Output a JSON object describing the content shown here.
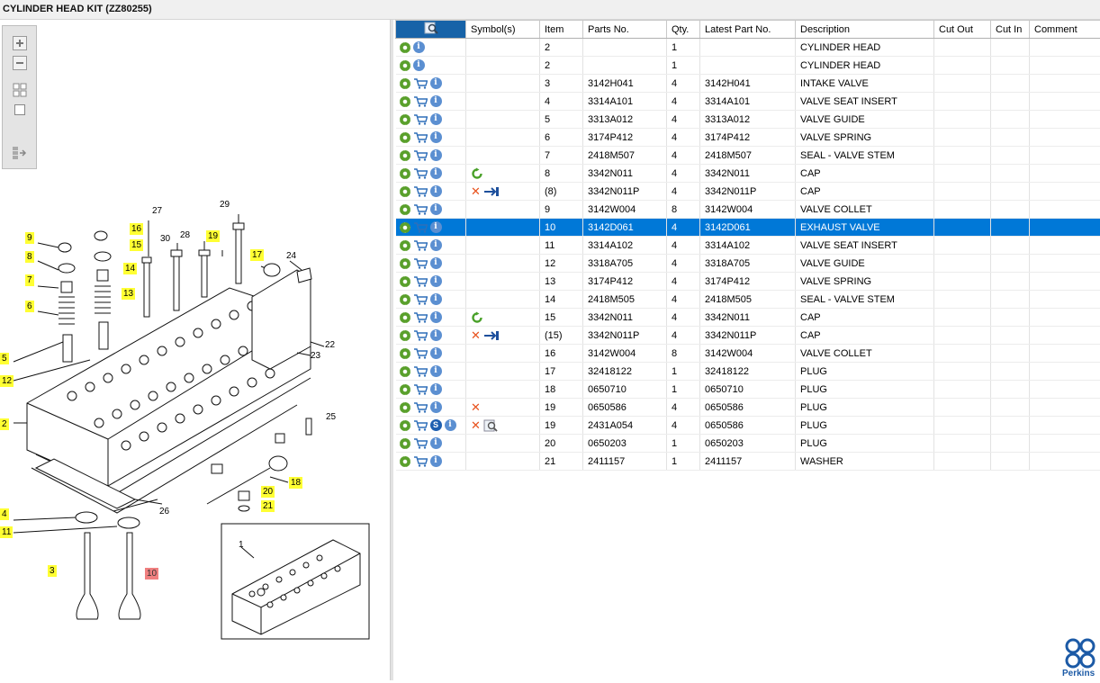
{
  "window": {
    "title": "CYLINDER HEAD KIT (ZZ80255)"
  },
  "toolbox": {
    "buttons": [
      "zoom-in",
      "zoom-out",
      "fit-all",
      "fit-window",
      "select-mode"
    ]
  },
  "diagram": {
    "callouts": [
      {
        "label": "9",
        "style": "hl"
      },
      {
        "label": "16",
        "style": "hl"
      },
      {
        "label": "15",
        "style": "hl"
      },
      {
        "label": "8",
        "style": "hl"
      },
      {
        "label": "14",
        "style": "hl"
      },
      {
        "label": "7",
        "style": "hl"
      },
      {
        "label": "13",
        "style": "hl"
      },
      {
        "label": "6",
        "style": "hl"
      },
      {
        "label": "5",
        "style": "hl"
      },
      {
        "label": "12",
        "style": "hl"
      },
      {
        "label": "2",
        "style": "hl"
      },
      {
        "label": "4",
        "style": "hl"
      },
      {
        "label": "11",
        "style": "hl"
      },
      {
        "label": "3",
        "style": "hl"
      },
      {
        "label": "10",
        "style": "sel"
      },
      {
        "label": "19",
        "style": "hl"
      },
      {
        "label": "17",
        "style": "hl"
      },
      {
        "label": "18",
        "style": "hl"
      },
      {
        "label": "20",
        "style": "hl"
      },
      {
        "label": "21",
        "style": "hl"
      },
      {
        "label": "27",
        "style": "plain"
      },
      {
        "label": "29",
        "style": "plain"
      },
      {
        "label": "30",
        "style": "plain"
      },
      {
        "label": "28",
        "style": "plain"
      },
      {
        "label": "24",
        "style": "plain"
      },
      {
        "label": "22",
        "style": "plain"
      },
      {
        "label": "23",
        "style": "plain"
      },
      {
        "label": "25",
        "style": "plain"
      },
      {
        "label": "26",
        "style": "plain"
      },
      {
        "label": "1",
        "style": "plain"
      }
    ]
  },
  "table": {
    "columns": [
      "",
      "Symbol(s)",
      "Item",
      "Parts No.",
      "Qty.",
      "Latest Part No.",
      "Description",
      "Cut Out",
      "Cut In",
      "Comment"
    ],
    "rows": [
      {
        "icons": [
          "gear",
          "info"
        ],
        "symbols": [],
        "item": "2",
        "part_no": "",
        "qty": "1",
        "latest": "",
        "desc": "CYLINDER HEAD",
        "cut_out": "",
        "cut_in": "",
        "comment": ""
      },
      {
        "icons": [
          "gear",
          "info"
        ],
        "symbols": [],
        "item": "2",
        "part_no": "",
        "qty": "1",
        "latest": "",
        "desc": "CYLINDER HEAD",
        "cut_out": "",
        "cut_in": "",
        "comment": ""
      },
      {
        "icons": [
          "gear",
          "cart",
          "info"
        ],
        "symbols": [],
        "item": "3",
        "part_no": "3142H041",
        "qty": "4",
        "latest": "3142H041",
        "desc": "INTAKE VALVE",
        "cut_out": "",
        "cut_in": "",
        "comment": ""
      },
      {
        "icons": [
          "gear",
          "cart",
          "info"
        ],
        "symbols": [],
        "item": "4",
        "part_no": "3314A101",
        "qty": "4",
        "latest": "3314A101",
        "desc": "VALVE SEAT INSERT",
        "cut_out": "",
        "cut_in": "",
        "comment": ""
      },
      {
        "icons": [
          "gear",
          "cart",
          "info"
        ],
        "symbols": [],
        "item": "5",
        "part_no": "3313A012",
        "qty": "4",
        "latest": "3313A012",
        "desc": "VALVE GUIDE",
        "cut_out": "",
        "cut_in": "",
        "comment": ""
      },
      {
        "icons": [
          "gear",
          "cart",
          "info"
        ],
        "symbols": [],
        "item": "6",
        "part_no": "3174P412",
        "qty": "4",
        "latest": "3174P412",
        "desc": "VALVE SPRING",
        "cut_out": "",
        "cut_in": "",
        "comment": ""
      },
      {
        "icons": [
          "gear",
          "cart",
          "info"
        ],
        "symbols": [],
        "item": "7",
        "part_no": "2418M507",
        "qty": "4",
        "latest": "2418M507",
        "desc": "SEAL - VALVE STEM",
        "cut_out": "",
        "cut_in": "",
        "comment": ""
      },
      {
        "icons": [
          "gear",
          "cart",
          "info"
        ],
        "symbols": [
          "refresh"
        ],
        "item": "8",
        "part_no": "3342N011",
        "qty": "4",
        "latest": "3342N011",
        "desc": "CAP",
        "cut_out": "",
        "cut_in": "",
        "comment": ""
      },
      {
        "icons": [
          "gear",
          "cart",
          "info"
        ],
        "symbols": [
          "cross",
          "arrow"
        ],
        "item": "(8)",
        "part_no": "3342N011P",
        "qty": "4",
        "latest": "3342N011P",
        "desc": "CAP",
        "cut_out": "",
        "cut_in": "",
        "comment": ""
      },
      {
        "icons": [
          "gear",
          "cart",
          "info"
        ],
        "symbols": [],
        "item": "9",
        "part_no": "3142W004",
        "qty": "8",
        "latest": "3142W004",
        "desc": "VALVE COLLET",
        "cut_out": "",
        "cut_in": "",
        "comment": ""
      },
      {
        "icons": [
          "gear",
          "cart",
          "info"
        ],
        "symbols": [],
        "item": "10",
        "part_no": "3142D061",
        "qty": "4",
        "latest": "3142D061",
        "desc": "EXHAUST VALVE",
        "cut_out": "",
        "cut_in": "",
        "comment": "",
        "selected": true
      },
      {
        "icons": [
          "gear",
          "cart",
          "info"
        ],
        "symbols": [],
        "item": "11",
        "part_no": "3314A102",
        "qty": "4",
        "latest": "3314A102",
        "desc": "VALVE SEAT INSERT",
        "cut_out": "",
        "cut_in": "",
        "comment": ""
      },
      {
        "icons": [
          "gear",
          "cart",
          "info"
        ],
        "symbols": [],
        "item": "12",
        "part_no": "3318A705",
        "qty": "4",
        "latest": "3318A705",
        "desc": "VALVE GUIDE",
        "cut_out": "",
        "cut_in": "",
        "comment": ""
      },
      {
        "icons": [
          "gear",
          "cart",
          "info"
        ],
        "symbols": [],
        "item": "13",
        "part_no": "3174P412",
        "qty": "4",
        "latest": "3174P412",
        "desc": "VALVE SPRING",
        "cut_out": "",
        "cut_in": "",
        "comment": ""
      },
      {
        "icons": [
          "gear",
          "cart",
          "info"
        ],
        "symbols": [],
        "item": "14",
        "part_no": "2418M505",
        "qty": "4",
        "latest": "2418M505",
        "desc": "SEAL - VALVE STEM",
        "cut_out": "",
        "cut_in": "",
        "comment": ""
      },
      {
        "icons": [
          "gear",
          "cart",
          "info"
        ],
        "symbols": [
          "refresh"
        ],
        "item": "15",
        "part_no": "3342N011",
        "qty": "4",
        "latest": "3342N011",
        "desc": "CAP",
        "cut_out": "",
        "cut_in": "",
        "comment": ""
      },
      {
        "icons": [
          "gear",
          "cart",
          "info"
        ],
        "symbols": [
          "cross",
          "arrow"
        ],
        "item": "(15)",
        "part_no": "3342N011P",
        "qty": "4",
        "latest": "3342N011P",
        "desc": "CAP",
        "cut_out": "",
        "cut_in": "",
        "comment": ""
      },
      {
        "icons": [
          "gear",
          "cart",
          "info"
        ],
        "symbols": [],
        "item": "16",
        "part_no": "3142W004",
        "qty": "8",
        "latest": "3142W004",
        "desc": "VALVE COLLET",
        "cut_out": "",
        "cut_in": "",
        "comment": ""
      },
      {
        "icons": [
          "gear",
          "cart",
          "info"
        ],
        "symbols": [],
        "item": "17",
        "part_no": "32418122",
        "qty": "1",
        "latest": "32418122",
        "desc": "PLUG",
        "cut_out": "",
        "cut_in": "",
        "comment": ""
      },
      {
        "icons": [
          "gear",
          "cart",
          "info"
        ],
        "symbols": [],
        "item": "18",
        "part_no": "0650710",
        "qty": "1",
        "latest": "0650710",
        "desc": "PLUG",
        "cut_out": "",
        "cut_in": "",
        "comment": ""
      },
      {
        "icons": [
          "gear",
          "cart",
          "info"
        ],
        "symbols": [
          "cross"
        ],
        "item": "19",
        "part_no": "0650586",
        "qty": "4",
        "latest": "0650586",
        "desc": "PLUG",
        "cut_out": "",
        "cut_in": "",
        "comment": ""
      },
      {
        "icons": [
          "gear",
          "cart",
          "s",
          "info"
        ],
        "symbols": [
          "cross",
          "search"
        ],
        "item": "19",
        "part_no": "2431A054",
        "qty": "4",
        "latest": "0650586",
        "desc": "PLUG",
        "cut_out": "",
        "cut_in": "",
        "comment": ""
      },
      {
        "icons": [
          "gear",
          "cart",
          "info"
        ],
        "symbols": [],
        "item": "20",
        "part_no": "0650203",
        "qty": "1",
        "latest": "0650203",
        "desc": "PLUG",
        "cut_out": "",
        "cut_in": "",
        "comment": ""
      },
      {
        "icons": [
          "gear",
          "cart",
          "info"
        ],
        "symbols": [],
        "item": "21",
        "part_no": "2411157",
        "qty": "1",
        "latest": "2411157",
        "desc": "WASHER",
        "cut_out": "",
        "cut_in": "",
        "comment": ""
      }
    ]
  },
  "brand": {
    "name": "Perkins",
    "color": "#1c5aa6"
  },
  "colors": {
    "selection": "#0078d7",
    "callout": "#ffff33",
    "callout_selected": "#f08080",
    "gear": "#5aa02c",
    "info": "#5b8fd1"
  }
}
